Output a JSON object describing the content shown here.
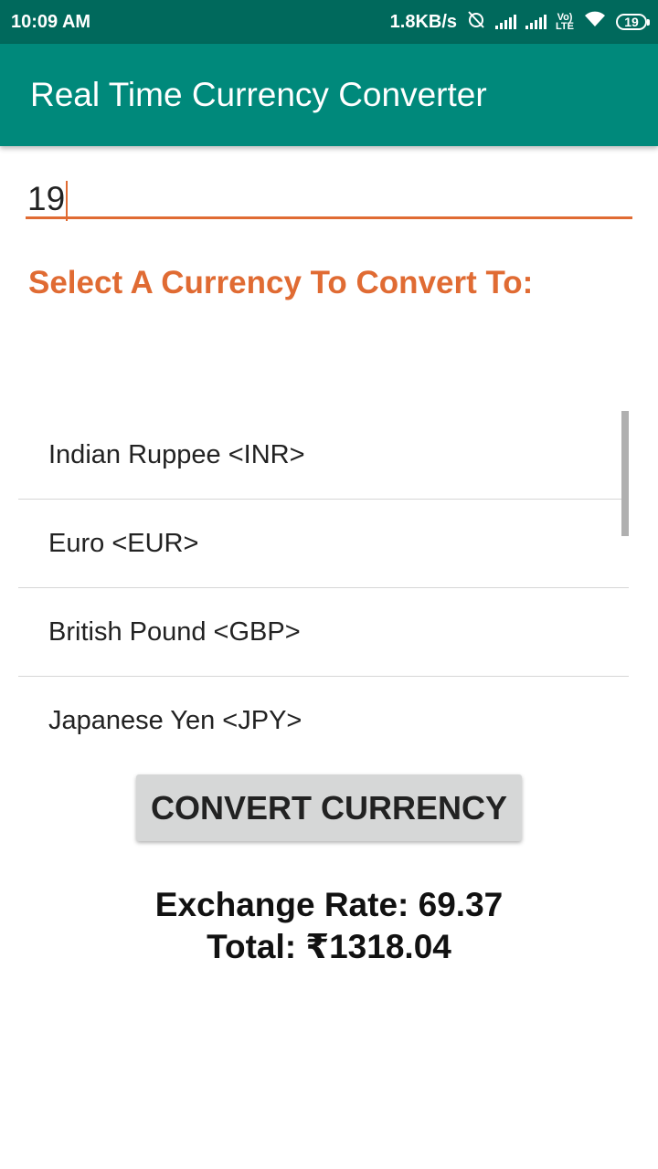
{
  "status_bar": {
    "time": "10:09 AM",
    "network_speed": "1.8KB/s",
    "volte_top": "Vo)",
    "volte_bottom": "LTE",
    "battery": "19"
  },
  "app_bar": {
    "title": "Real Time Currency Converter"
  },
  "amount_input": {
    "value": "19"
  },
  "prompt": {
    "label": "Select A Currency To Convert To:"
  },
  "currency_list": {
    "items": [
      "Indian Ruppee <INR>",
      "Euro <EUR>",
      "British Pound <GBP>",
      "Japanese Yen <JPY>"
    ]
  },
  "convert_button": {
    "label": "CONVERT CURRENCY"
  },
  "result": {
    "exchange_rate_line": "Exchange Rate: 69.37",
    "total_line": "Total: ₹1318.04"
  },
  "colors": {
    "status_bar": "#00695c",
    "app_bar": "#00897b",
    "accent": "#e06b33",
    "button": "#d6d7d7"
  }
}
